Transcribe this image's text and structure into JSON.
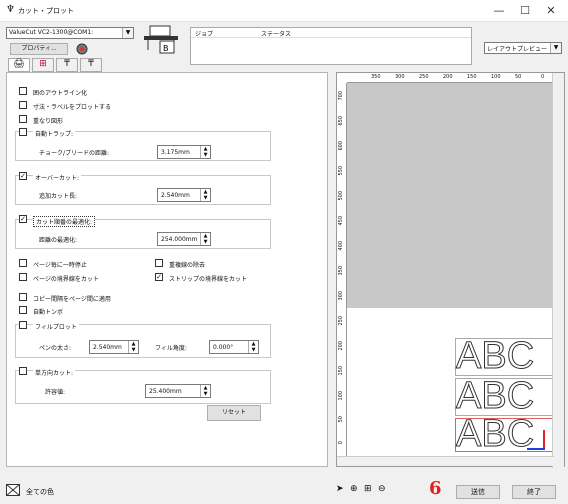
{
  "window": {
    "title": "カット・プロット",
    "icon": "plotter-icon",
    "min_label": "—",
    "max_label": "☐",
    "close_label": "✕"
  },
  "device": {
    "selected": "ValueCut VC2-1300@COM1:",
    "properties_label": "プロパティ..."
  },
  "job_table": {
    "col_job": "ジョブ",
    "col_status": "ステータス"
  },
  "layout_select": {
    "selected": "レイアウトプレビュー"
  },
  "options": {
    "weed_outline": "囲のアウトライン化",
    "plot_dimensions": "寸法・ラベルをプロットする",
    "overlap": "重なり図形",
    "auto_trap_label": "自動トラップ:",
    "choke_label": "チョーク/ブリードの距離:",
    "choke_value": "3.175mm",
    "overcut_label": "オーバーカット:",
    "overcut_length_label": "追加カット長:",
    "overcut_value": "2.540mm",
    "optimize_label": "カット順番の最適化:",
    "optimize_dist_label": "距離の最適化:",
    "optimize_value": "254.000mm",
    "pause_each_page": "ページ毎に一時停止",
    "remove_overlap": "重複線の除去",
    "cut_page_border": "ページの境界線をカット",
    "cut_strip_border": "ストリップの境界線をカット",
    "copy_spacing": "コピー間隔をページ間に適用",
    "auto_tonbo": "自動トンボ",
    "fill_plot_label": "フィルプロット",
    "pen_width_label": "ペンの太さ:",
    "pen_width_value": "2.540mm",
    "fill_angle_label": "フィル角度:",
    "fill_angle_value": "0.000°",
    "one_direction_label": "単方向カット:",
    "tolerance_label": "許容値:",
    "tolerance_value": "25.400mm",
    "reset_label": "リセット"
  },
  "checks": {
    "overcut": true,
    "optimize": true,
    "cut_strip_border": true
  },
  "ruler": {
    "top_ticks": [
      "350",
      "300",
      "250",
      "200",
      "150",
      "100",
      "50",
      "0"
    ],
    "left_ticks": [
      "700",
      "650",
      "600",
      "550",
      "500",
      "450",
      "400",
      "350",
      "300",
      "250",
      "200",
      "150",
      "100",
      "50",
      "0"
    ]
  },
  "preview": {
    "text_rows": [
      "ABC",
      "ABC",
      "ABC"
    ]
  },
  "status": {
    "color_label": "全ての色",
    "annotation": "6",
    "send_label": "送信",
    "exit_label": "終了"
  },
  "colors": {
    "annotation": "#e02020"
  }
}
